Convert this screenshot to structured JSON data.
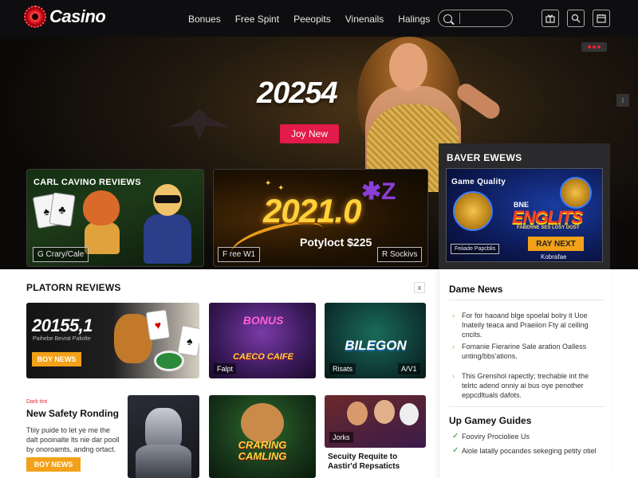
{
  "header": {
    "logo_text": "Casino",
    "nav": [
      "Bonues",
      "Free Spint",
      "Peeopits",
      "Vinenails",
      "Halings"
    ],
    "search": {
      "placeholder": ""
    },
    "icons": [
      "gift-icon",
      "search-icon",
      "calendar-icon"
    ]
  },
  "hero": {
    "title": "20254",
    "cta_label": "Joy New",
    "cards": [
      {
        "title": "CARL CAVINO REVIEWS",
        "chip": "G Crary/Cale"
      },
      {
        "headline": "2021.0",
        "payout": "Potyloct $225",
        "chip_left": "F ree W1",
        "chip_right": "R Sockivs"
      },
      {
        "title": "BAVER EWEWS",
        "subtitle": "Game Quality",
        "banner": "ENGLITS",
        "banner_top": "BNE",
        "tagline": "FABERNE SES LOSY DOST",
        "btn": "RAY NEXT",
        "chip": "Feiiade Papcblis",
        "foot": "Kobrafae"
      }
    ]
  },
  "platform": {
    "title": "PLATORN REVIEWS",
    "close": "x",
    "tiles": [
      {
        "big": "20155,1",
        "sub": "Paihebe Bevrat Paliolte",
        "btn": "BOY NEWS"
      },
      {
        "word_top": "BONUS",
        "word_bottom": "CAECO CAIFE",
        "chip": "Falpt"
      },
      {
        "word": "BILEGON",
        "chip_left": "Risats",
        "chip_right": "A/V1"
      },
      {
        "word": "CRARING CAMLING"
      },
      {
        "chip": "Jorks"
      }
    ],
    "news": {
      "tag": "Dark tint",
      "title": "New Safety Ronding",
      "body": "Ttiiy puide to let ye me the dalt pooinalte lts nie dar pooll by onoroamts, andng ortact.",
      "btn": "BOY NEWS"
    },
    "caption": "Secuity Requite to Aastir'd Repsaticts"
  },
  "sidebar": {
    "news_title": "Dame News",
    "news_items": [
      "For for haoand blge spoelal bolry it Uoe Inateily teaca and Praeiion Fty al ceiling cncits.",
      "Fomanie Fierarine Sale aration Oalless unting/bbs'ations.",
      "This Grenshol rapectly; trechable int the telrtc adend onniy ai bus oye penother eppcdltuals dafots."
    ],
    "guides_title": "Up Gamey Guides",
    "guide_items": [
      "Fooviry Procioliee Us",
      "Aiole latally pocandes sekeging petity otiel"
    ]
  }
}
